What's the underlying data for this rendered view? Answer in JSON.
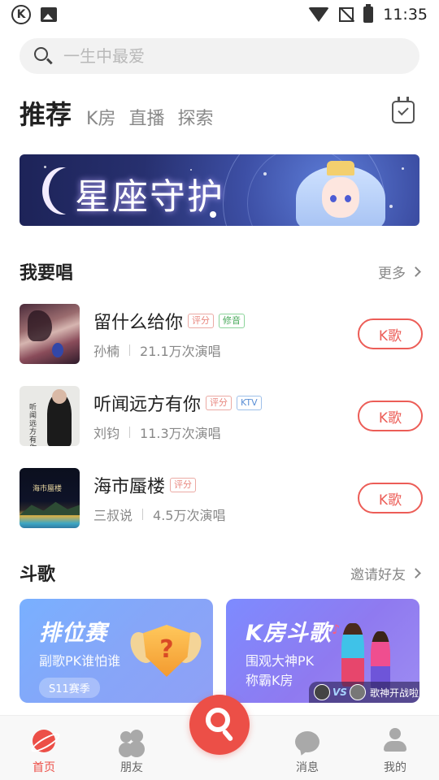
{
  "status_bar": {
    "time": "11:35",
    "icons": [
      "k-app-icon",
      "image-icon",
      "wifi-icon",
      "signal-off-icon",
      "battery-charging-icon"
    ]
  },
  "search": {
    "placeholder": "一生中最爱"
  },
  "tabs": [
    {
      "label": "推荐",
      "active": true
    },
    {
      "label": "K房",
      "active": false
    },
    {
      "label": "直播",
      "active": false
    },
    {
      "label": "探索",
      "active": false
    }
  ],
  "banner": {
    "title": "星座守护"
  },
  "sing_section": {
    "title": "我要唱",
    "more_label": "更多",
    "songs": [
      {
        "name": "留什么给你",
        "tags": [
          "评分",
          "修音"
        ],
        "artist": "孙楠",
        "plays": "21.1万次演唱",
        "button": "K歌"
      },
      {
        "name": "听闻远方有你",
        "tags": [
          "评分",
          "KTV"
        ],
        "artist": "刘钧",
        "plays": "11.3万次演唱",
        "button": "K歌"
      },
      {
        "name": "海市蜃楼",
        "tags": [
          "评分"
        ],
        "artist": "三叔说",
        "plays": "4.5万次演唱",
        "button": "K歌"
      }
    ]
  },
  "battle_section": {
    "title": "斗歌",
    "invite_label": "邀请好友",
    "cards": [
      {
        "title": "排位赛",
        "subtitle": "副歌PK谁怕谁",
        "pill": "S11赛季"
      },
      {
        "title": "K房斗歌",
        "subtitle_line1": "围观大神PK",
        "subtitle_line2": "称霸K房",
        "vs_label": "VS",
        "strip_text": "歌神开战啦"
      }
    ]
  },
  "bottom_nav": [
    {
      "label": "首页",
      "active": true
    },
    {
      "label": "朋友",
      "active": false
    },
    {
      "label": "消息",
      "active": false
    },
    {
      "label": "我的",
      "active": false
    }
  ],
  "colors": {
    "accent": "#ec4f47",
    "tag_red": "#e8867e",
    "tag_green": "#48a95a",
    "tag_blue": "#5a8fd6"
  }
}
